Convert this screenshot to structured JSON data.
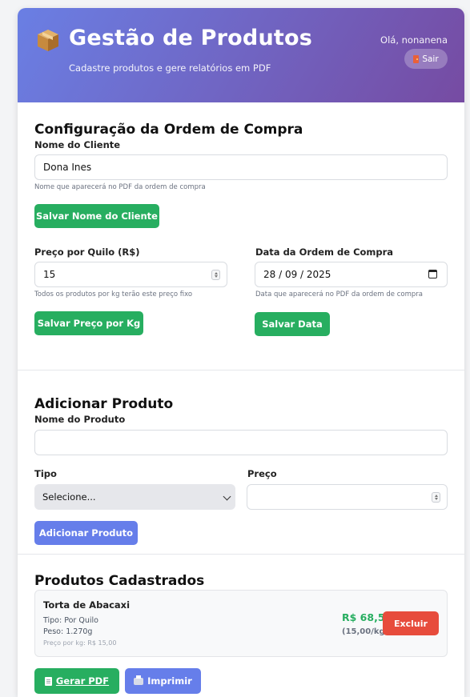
{
  "header": {
    "title": "Gestão de Produtos",
    "subtitle": "Cadastre produtos e gere relatórios em PDF",
    "greeting": "Olá, nonanena",
    "logout_label": "Sair",
    "icon": "package-icon"
  },
  "config": {
    "title": "Configuração da Ordem de Compra",
    "client_label": "Nome do Cliente",
    "client_value": "Dona Ines",
    "client_hint": "Nome que aparecerá no PDF da ordem de compra",
    "save_client_label": "Salvar Nome do Cliente",
    "price_label": "Preço por Quilo (R$)",
    "price_value": "15",
    "price_hint": "Todos os produtos por kg terão este preço fixo",
    "save_price_label": "Salvar Preço por Kg",
    "date_label": "Data da Ordem de Compra",
    "date_value": "28 / 09 / 2025",
    "date_hint": "Data que aparecerá no PDF da ordem de compra",
    "save_date_label": "Salvar Data"
  },
  "add_product": {
    "title": "Adicionar Produto",
    "name_label": "Nome do Produto",
    "name_value": "",
    "type_label": "Tipo",
    "type_selected": "Selecione...",
    "price_label": "Preço",
    "price_value": "",
    "submit_label": "Adicionar Produto"
  },
  "products": {
    "title": "Produtos Cadastrados",
    "items": [
      {
        "name": "Torta de Abacaxi",
        "type": "Tipo: Por Quilo",
        "weight": "Peso: 1.270g",
        "price_per_kg": "Preço por kg: R$ 15,00",
        "total": "R$ 68,58",
        "unit_price": "(15,00/kg)",
        "delete_label": "Excluir"
      }
    ],
    "pdf_label": "Gerar PDF",
    "print_label": "Imprimir"
  },
  "colors": {
    "header_start": "#6a7fe4",
    "header_end": "#764ba2",
    "green": "#27ae60",
    "blue": "#667eea",
    "red": "#e74c3c"
  }
}
